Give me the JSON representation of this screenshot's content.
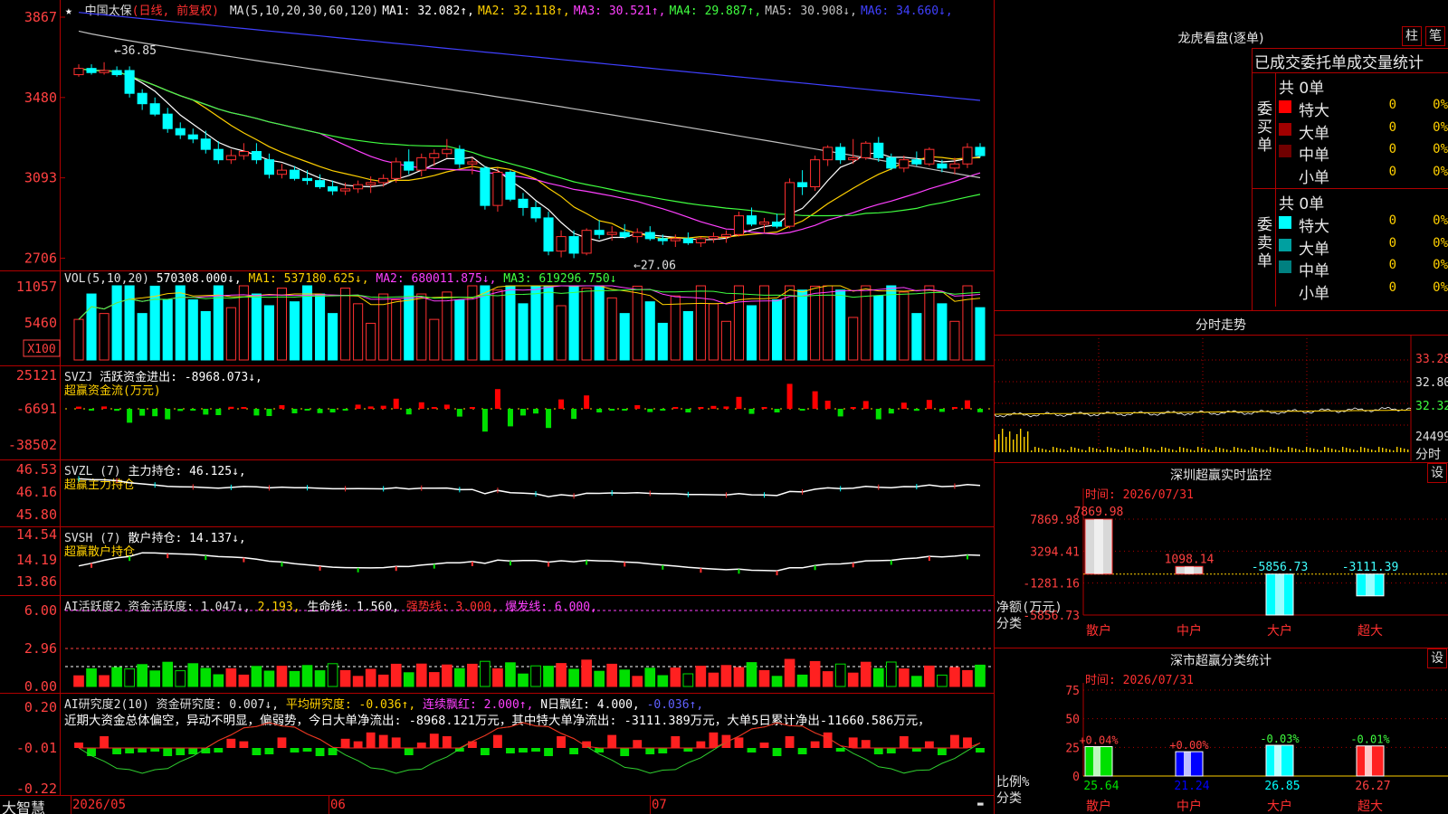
{
  "app_name": "大智慧",
  "stock": {
    "name": "中国太保",
    "mode": "(日线, 前复权)"
  },
  "main_chart": {
    "ma_labels": [
      {
        "text": "MA(5,10,20,30,60,120)",
        "color": "#e0e0e0"
      },
      {
        "text": "MA1: 32.082↑",
        "color": "#ffffff"
      },
      {
        "text": "MA2: 32.118↑",
        "color": "#ffd000"
      },
      {
        "text": "MA3: 30.521↑",
        "color": "#ff40ff"
      },
      {
        "text": "MA4: 29.887↑",
        "color": "#40ff40"
      },
      {
        "text": "MA5: 30.908↓",
        "color": "#c0c0c0"
      },
      {
        "text": "MA6: 34.660↓",
        "color": "#4040ff"
      }
    ],
    "y_ticks": [
      "3867",
      "3480",
      "3093",
      "2706"
    ],
    "high_label": "36.85",
    "low_label": "27.06",
    "candles": [
      [
        35.9,
        36.4,
        35.8,
        36.2
      ],
      [
        36.2,
        36.4,
        35.9,
        36.0
      ],
      [
        36.0,
        36.5,
        35.9,
        36.1
      ],
      [
        36.1,
        36.3,
        35.8,
        35.9
      ],
      [
        36.1,
        36.3,
        34.8,
        35.0
      ],
      [
        35.0,
        35.2,
        34.2,
        34.5
      ],
      [
        34.5,
        34.8,
        33.9,
        34.0
      ],
      [
        34.0,
        34.3,
        33.1,
        33.3
      ],
      [
        33.3,
        33.6,
        32.8,
        33.0
      ],
      [
        33.0,
        33.3,
        32.6,
        32.8
      ],
      [
        32.8,
        33.2,
        32.1,
        32.3
      ],
      [
        32.3,
        32.7,
        31.6,
        31.8
      ],
      [
        31.8,
        32.3,
        31.6,
        32.0
      ],
      [
        32.0,
        32.6,
        31.8,
        32.2
      ],
      [
        32.2,
        32.6,
        31.6,
        31.8
      ],
      [
        31.8,
        32.1,
        30.9,
        31.1
      ],
      [
        31.1,
        31.6,
        30.9,
        31.3
      ],
      [
        31.3,
        31.5,
        30.8,
        30.9
      ],
      [
        30.9,
        31.3,
        30.6,
        30.8
      ],
      [
        30.8,
        31.1,
        30.4,
        30.5
      ],
      [
        30.5,
        30.8,
        30.1,
        30.3
      ],
      [
        30.3,
        30.7,
        30.1,
        30.4
      ],
      [
        30.4,
        30.8,
        30.2,
        30.6
      ],
      [
        30.6,
        31.0,
        30.2,
        30.7
      ],
      [
        30.7,
        31.1,
        30.5,
        30.9
      ],
      [
        30.9,
        31.9,
        30.7,
        31.7
      ],
      [
        31.7,
        32.3,
        31.1,
        31.3
      ],
      [
        31.3,
        32.1,
        31.0,
        31.9
      ],
      [
        31.9,
        32.3,
        31.5,
        32.1
      ],
      [
        32.1,
        32.8,
        31.9,
        32.3
      ],
      [
        32.3,
        32.5,
        31.4,
        31.6
      ],
      [
        31.6,
        31.9,
        31.1,
        31.7
      ],
      [
        31.4,
        31.5,
        29.4,
        29.6
      ],
      [
        29.6,
        31.4,
        29.3,
        31.2
      ],
      [
        31.2,
        31.3,
        29.8,
        29.9
      ],
      [
        29.9,
        30.2,
        29.1,
        29.5
      ],
      [
        29.5,
        29.8,
        28.8,
        29.0
      ],
      [
        29.0,
        29.3,
        27.2,
        27.4
      ],
      [
        27.4,
        28.4,
        27.1,
        28.1
      ],
      [
        28.1,
        28.4,
        27.06,
        27.3
      ],
      [
        27.3,
        28.5,
        27.2,
        28.4
      ],
      [
        28.4,
        28.9,
        28.0,
        28.2
      ],
      [
        28.2,
        28.6,
        27.9,
        28.3
      ],
      [
        28.3,
        28.7,
        28.0,
        28.1
      ],
      [
        28.1,
        28.5,
        27.8,
        28.3
      ],
      [
        28.3,
        28.6,
        27.9,
        28.0
      ],
      [
        28.0,
        28.2,
        27.7,
        27.9
      ],
      [
        27.9,
        28.2,
        27.6,
        28.0
      ],
      [
        28.0,
        28.3,
        27.7,
        27.8
      ],
      [
        27.8,
        28.1,
        27.6,
        28.0
      ],
      [
        28.0,
        28.3,
        27.8,
        28.1
      ],
      [
        28.1,
        28.4,
        27.8,
        28.2
      ],
      [
        28.2,
        29.3,
        28.1,
        29.1
      ],
      [
        29.1,
        29.5,
        28.6,
        28.7
      ],
      [
        28.7,
        29.0,
        28.3,
        28.8
      ],
      [
        28.8,
        29.2,
        28.5,
        28.6
      ],
      [
        28.6,
        30.9,
        28.5,
        30.7
      ],
      [
        30.7,
        31.3,
        30.1,
        30.5
      ],
      [
        30.5,
        32.0,
        30.3,
        31.8
      ],
      [
        31.8,
        32.5,
        31.5,
        32.4
      ],
      [
        32.4,
        32.6,
        31.6,
        31.8
      ],
      [
        31.8,
        32.8,
        31.6,
        31.9
      ],
      [
        31.9,
        32.7,
        31.8,
        32.6
      ],
      [
        32.6,
        32.9,
        31.7,
        31.9
      ],
      [
        31.9,
        32.1,
        31.3,
        31.4
      ],
      [
        31.4,
        32.0,
        31.2,
        31.8
      ],
      [
        31.8,
        32.2,
        31.5,
        31.6
      ],
      [
        31.6,
        32.4,
        31.5,
        32.3
      ],
      [
        31.6,
        31.8,
        31.2,
        31.4
      ],
      [
        31.4,
        31.9,
        31.1,
        31.6
      ],
      [
        31.6,
        32.6,
        31.4,
        32.4
      ],
      [
        32.4,
        32.6,
        31.9,
        32.0
      ]
    ]
  },
  "volume": {
    "title": "VOL(5,10,20)",
    "value": "570308.000↓,",
    "ma1": "MA1: 537180.625↓,",
    "ma2": "MA2: 680011.875↓,",
    "ma3": "MA3: 619296.750↓",
    "y_ticks": [
      "11057",
      "5460"
    ],
    "unit": "X100"
  },
  "svzj": {
    "title": "SVZJ",
    "label": "活跃资金进出: -8968.073↓,",
    "subtitle": "超赢资金流(万元)",
    "y_ticks": [
      "25121",
      "-6691",
      "-38502"
    ]
  },
  "svzl": {
    "title": "SVZL (7)",
    "label": "主力持仓: 46.125↓,",
    "subtitle": "超赢主力持仓",
    "y_ticks": [
      "46.53",
      "46.16",
      "45.80"
    ]
  },
  "svsh": {
    "title": "SVSH (7)",
    "label": "散户持仓: 14.137↓,",
    "subtitle": "超赢散户持仓",
    "y_ticks": [
      "14.54",
      "14.19",
      "13.86"
    ]
  },
  "ai_active": {
    "title": "AI活跃度2 资金活跃度: 1.047↓,",
    "v2": "2.193,",
    "v3": "生命线: 1.560,",
    "v4": "强势线: 3.000,",
    "v5": "爆发线: 6.000,",
    "y_ticks": [
      "6.00",
      "2.96",
      "0.00"
    ]
  },
  "ai_research": {
    "title": "AI研究度2(10) 资金研究度: 0.007↓,",
    "v2": "平均研究度: -0.036↑,",
    "v3": "连续飘红: 2.000↑,",
    "v4": "N日飘红: 4.000,",
    "v5": "-0.036↑,",
    "comment": "近期大资金总体偏空，异动不明显，偏弱势，今日大单净流出: -8968.121万元，其中特大单净流出: -3111.389万元，大单5日累计净出-11660.586万元，",
    "y_ticks": [
      "0.20",
      "-0.01",
      "-0.22"
    ]
  },
  "x_axis": {
    "labels": [
      "2026/05",
      "06",
      "07"
    ]
  },
  "right_panel": {
    "lhkp_title": "龙虎看盘(逐单)",
    "btn_zhu": "柱",
    "btn_bi": "笔",
    "trade_header": "已成交委托单成交量统计",
    "buy_side": {
      "label": "委买单",
      "total": "共 0单",
      "rows": [
        {
          "name": "特大",
          "count": "0",
          "pct": "0%",
          "color": "#ff0000"
        },
        {
          "name": "大单",
          "count": "0",
          "pct": "0%",
          "color": "#a00000"
        },
        {
          "name": "中单",
          "count": "0",
          "pct": "0%",
          "color": "#700000"
        },
        {
          "name": "小单",
          "count": "0",
          "pct": "0%",
          "color": ""
        }
      ]
    },
    "sell_side": {
      "label": "委卖单",
      "total": "共 0单",
      "rows": [
        {
          "name": "特大",
          "count": "0",
          "pct": "0%",
          "color": "#00ffff"
        },
        {
          "name": "大单",
          "count": "0",
          "pct": "0%",
          "color": "#00a0a0"
        },
        {
          "name": "中单",
          "count": "0",
          "pct": "0%",
          "color": "#008080"
        },
        {
          "name": "小单",
          "count": "0",
          "pct": "0%",
          "color": ""
        }
      ]
    },
    "intraday": {
      "title": "分时走势",
      "y_ticks": [
        "33.28",
        "32.80",
        "32.32"
      ],
      "vol_tick": "24499",
      "x_label": "分时"
    },
    "sz_monitor": {
      "title": "深圳超赢实时监控",
      "btn": "设",
      "time": "时间: 2026/07/31",
      "y_ticks": [
        "7869.98",
        "3294.41",
        "-1281.16",
        "-5856.73"
      ],
      "ylabel": "净额(万元)",
      "xlabel": "分类",
      "categories": [
        "散户",
        "中户",
        "大户",
        "超大"
      ],
      "values": [
        7869.98,
        1098.14,
        -5856.73,
        -3111.39
      ],
      "value_labels": [
        "7869.98",
        "1098.14",
        "-5856.73",
        "-3111.39"
      ]
    },
    "sz_class": {
      "title": "深市超赢分类统计",
      "btn": "设",
      "time": "时间: 2026/07/31",
      "y_ticks": [
        "75",
        "50",
        "25",
        "0"
      ],
      "ylabel": "比例%",
      "xlabel": "分类",
      "categories": [
        "散户",
        "中户",
        "大户",
        "超大"
      ],
      "values": [
        25.64,
        21.24,
        26.85,
        26.27
      ],
      "value_labels": [
        "25.64",
        "21.24",
        "26.85",
        "26.27"
      ],
      "change_labels": [
        "+0.04%",
        "+0.00%",
        "-0.03%",
        "-0.01%"
      ]
    }
  },
  "chart_data": [
    {
      "type": "bar",
      "title": "深圳超赢实时监控",
      "xlabel": "分类",
      "ylabel": "净额(万元)",
      "categories": [
        "散户",
        "中户",
        "大户",
        "超大"
      ],
      "values": [
        7869.98,
        1098.14,
        -5856.73,
        -3111.39
      ],
      "ylim": [
        -5856.73,
        7869.98
      ]
    },
    {
      "type": "bar",
      "title": "深市超赢分类统计",
      "xlabel": "分类",
      "ylabel": "比例%",
      "categories": [
        "散户",
        "中户",
        "大户",
        "超大"
      ],
      "values": [
        25.64,
        21.24,
        26.85,
        26.27
      ],
      "ylim": [
        0,
        75
      ]
    }
  ]
}
